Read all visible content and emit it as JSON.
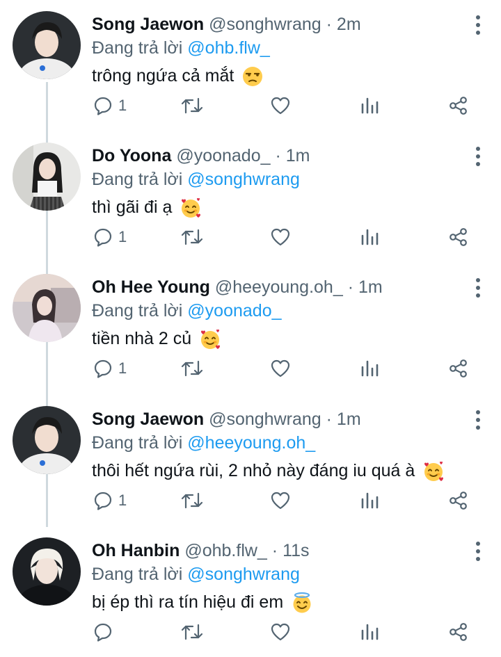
{
  "labels": {
    "replying": "Đang trả lời"
  },
  "colors": {
    "accent": "#1d9bf0",
    "secondary": "#536471",
    "line": "#cfd9de"
  },
  "tweets": [
    {
      "name": "Song Jaewon",
      "handle": "@songhwrang",
      "dot": "·",
      "time": "2m",
      "reply_to": "@ohb.flw_",
      "text": "trông ngứa cả mắt",
      "emoji": "unamused-face",
      "reply_count": "1"
    },
    {
      "name": "Do Yoona",
      "handle": "@yoonado_",
      "dot": "·",
      "time": "1m",
      "reply_to": "@songhwrang",
      "text": "thì gãi đi ạ",
      "emoji": "smiling-face-with-hearts",
      "reply_count": "1"
    },
    {
      "name": "Oh Hee Young",
      "handle": "@heeyoung.oh_",
      "dot": "·",
      "time": "1m",
      "reply_to": "@yoonado_",
      "text": "tiền nhà 2 củ",
      "emoji": "smiling-face-with-hearts",
      "reply_count": "1"
    },
    {
      "name": "Song Jaewon",
      "handle": "@songhwrang",
      "dot": "·",
      "time": "1m",
      "reply_to": "@heeyoung.oh_",
      "text": "thôi hết ngứa rùi, 2 nhỏ này đáng iu quá à",
      "emoji": "smiling-face-with-hearts",
      "reply_count": "1"
    },
    {
      "name": "Oh Hanbin",
      "handle": "@ohb.flw_",
      "dot": "·",
      "time": "11s",
      "reply_to": "@songhwrang",
      "text": "bị ép thì ra tín hiệu đi em",
      "emoji": "smiling-face-with-halo",
      "reply_count": ""
    }
  ],
  "icons": [
    "reply-icon",
    "retweet-icon",
    "like-icon",
    "analytics-icon",
    "share-icon",
    "more-icon"
  ]
}
